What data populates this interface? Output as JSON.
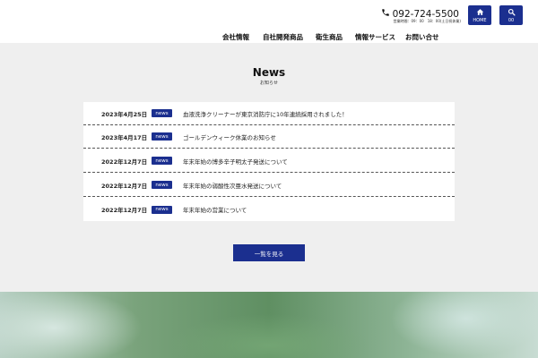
{
  "header": {
    "phone": "092-724-5500",
    "hours": "営業時間：09：00　18：00(土日祝休業)",
    "home_label": "HOME",
    "search_label": "00"
  },
  "nav": {
    "items": [
      {
        "label": "会社情報"
      },
      {
        "label": "自社開発商品"
      },
      {
        "label": "衛生商品"
      },
      {
        "label": "情報サービス"
      },
      {
        "label": "お問い合せ"
      }
    ]
  },
  "news": {
    "title": "News",
    "subtitle": "お知らせ",
    "items": [
      {
        "date": "2023年4月25日",
        "tag": "news",
        "text": "血液洗浄クリーナーが東京消防庁に10年連続採用されました！"
      },
      {
        "date": "2023年4月17日",
        "tag": "news",
        "text": "ゴールデンウィーク休業のお知らせ"
      },
      {
        "date": "2022年12月7日",
        "tag": "news",
        "text": "年末年始の博多辛子明太子発送について"
      },
      {
        "date": "2022年12月7日",
        "tag": "news",
        "text": "年末年始の弱酸性次亜水発送について"
      },
      {
        "date": "2022年12月7日",
        "tag": "news",
        "text": "年末年始の営業について"
      }
    ],
    "more_label": "一覧を見る"
  },
  "colors": {
    "accent": "#1b2f8f",
    "background": "#efefef"
  }
}
